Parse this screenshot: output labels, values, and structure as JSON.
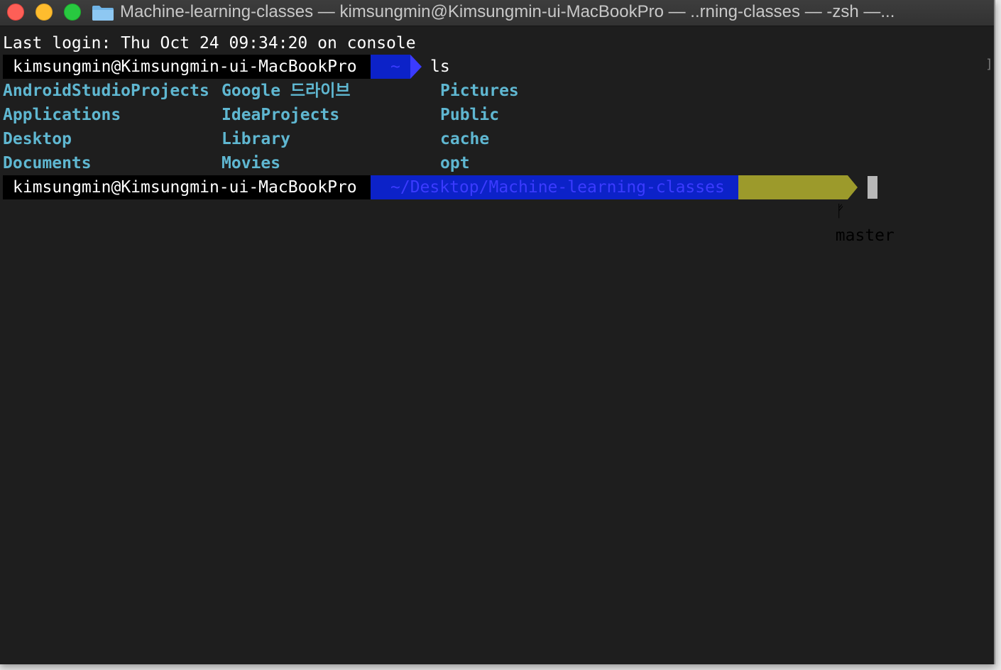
{
  "window": {
    "title": "Machine-learning-classes — kimsungmin@Kimsungmin-ui-MacBookPro — ..rning-classes — -zsh —..."
  },
  "terminal": {
    "last_login": "Last login: Thu Oct 24 09:34:20 on console",
    "prompt1": {
      "user_host": "kimsungmin@Kimsungmin-ui-MacBookPro",
      "dir": "~",
      "command": "ls"
    },
    "ls_output": {
      "col1": [
        "AndroidStudioProjects",
        "Applications",
        "Desktop",
        "Documents"
      ],
      "col2": [
        "Google 드라이브",
        "IdeaProjects",
        "Library",
        "Movies"
      ],
      "col3": [
        "Pictures",
        "Public",
        "cache",
        "opt"
      ]
    },
    "prompt2": {
      "user_host": "kimsungmin@Kimsungmin-ui-MacBookPro",
      "dir": "~/Desktop/Machine-learning-classes",
      "branch_icon": "ᚠ",
      "branch": "master"
    }
  },
  "colors": {
    "background": "#1e1e1e",
    "prompt_user_bg": "#000000",
    "prompt_dir_bg": "#0c22c8",
    "prompt_dir_fg": "#3b3bff",
    "prompt_git_bg": "#9c9a2b",
    "directory_fg": "#5fb7d1"
  }
}
